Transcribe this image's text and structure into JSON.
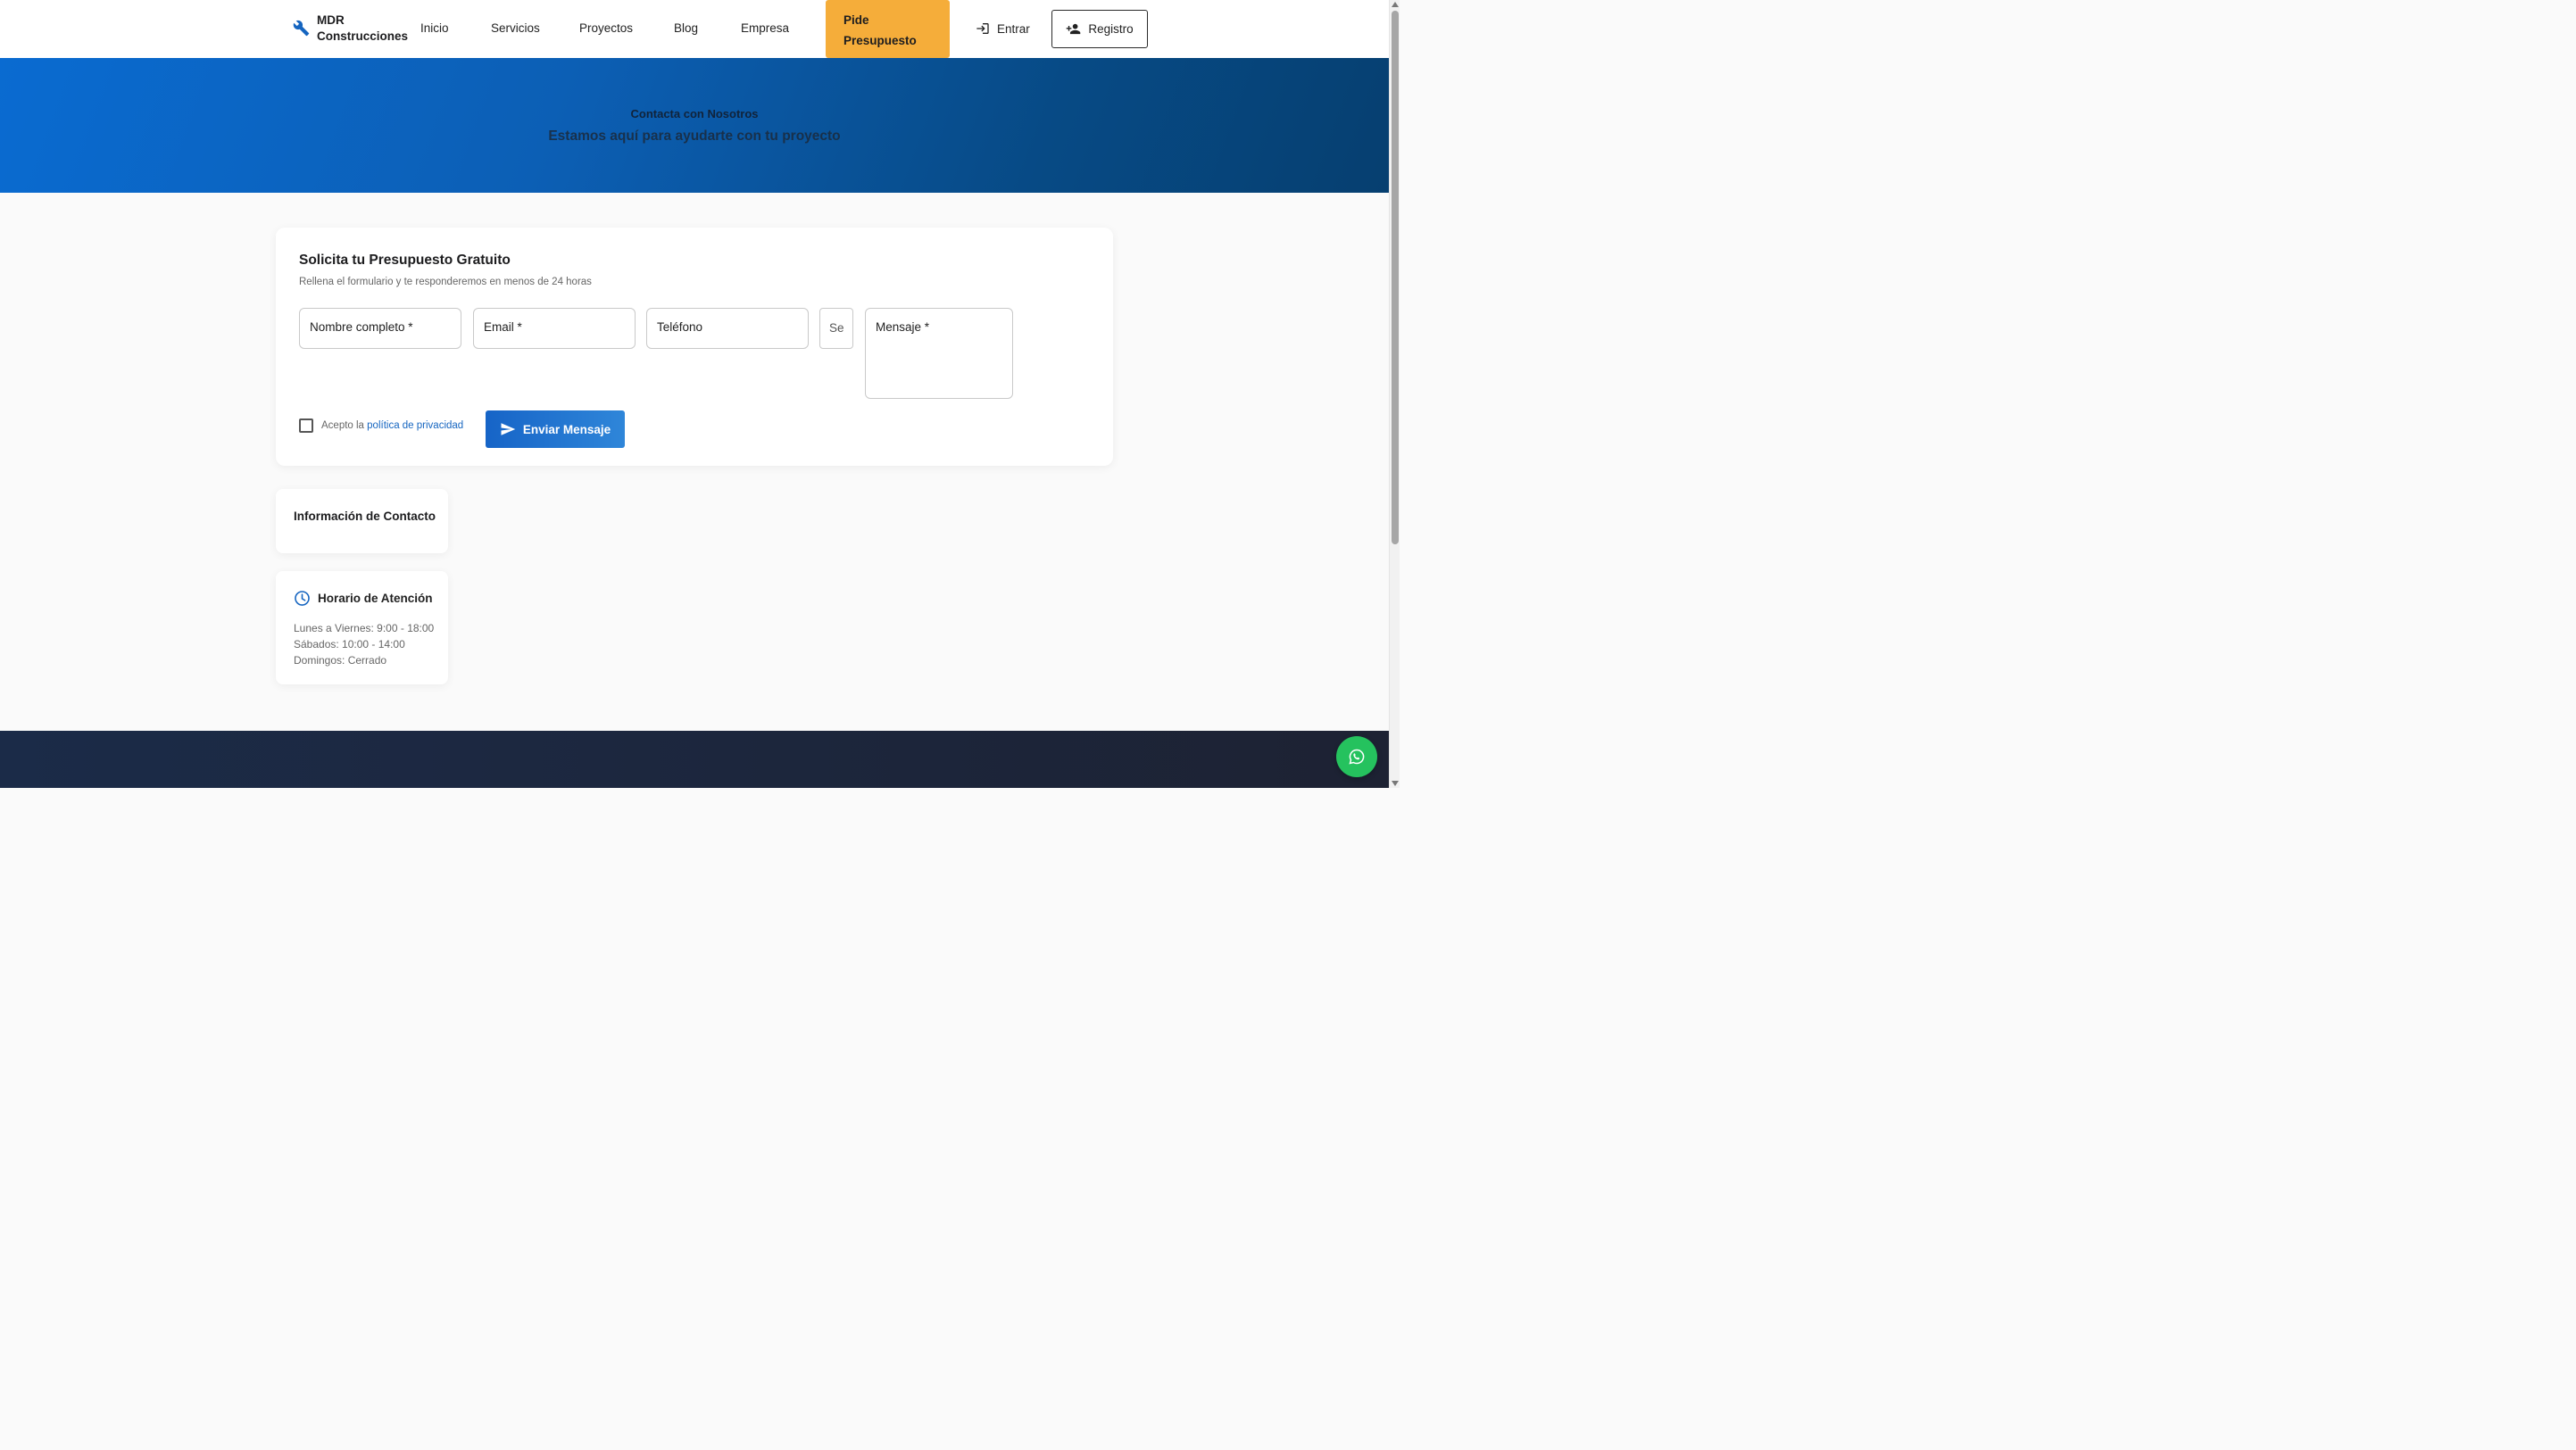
{
  "brand": {
    "name_line1": "MDR",
    "name_line2": "Construcciones",
    "icon": "wrench-icon"
  },
  "nav": {
    "items": [
      {
        "label": "Inicio"
      },
      {
        "label": "Servicios"
      },
      {
        "label": "Proyectos"
      },
      {
        "label": "Blog"
      },
      {
        "label": "Empresa"
      }
    ],
    "cta_line1": "Pide",
    "cta_line2": "Presupuesto",
    "login": "Entrar",
    "register": "Registro"
  },
  "hero": {
    "title": "Contacta con Nosotros",
    "subtitle": "Estamos aquí para ayudarte con tu proyecto"
  },
  "form": {
    "title": "Solicita tu Presupuesto Gratuito",
    "subtitle": "Rellena el formulario y te responderemos en menos de 24 horas",
    "name_label": "Nombre completo *",
    "email_label": "Email *",
    "phone_label": "Teléfono",
    "service_value": "Se",
    "message_label": "Mensaje *",
    "accept_text": "Acepto la ",
    "privacy_link": "política de privacidad",
    "submit": "Enviar Mensaje"
  },
  "contact_info": {
    "title": "Información de Contacto"
  },
  "hours": {
    "title": "Horario de Atención",
    "lines": [
      "Lunes a Viernes: 9:00 - 18:00",
      "Sábados: 10:00 - 14:00",
      "Domingos: Cerrado"
    ]
  },
  "colors": {
    "primary": "#0c5fb5",
    "accent": "#f5ad3a",
    "whatsapp": "#25c25e",
    "footer": "#1b2b48"
  }
}
